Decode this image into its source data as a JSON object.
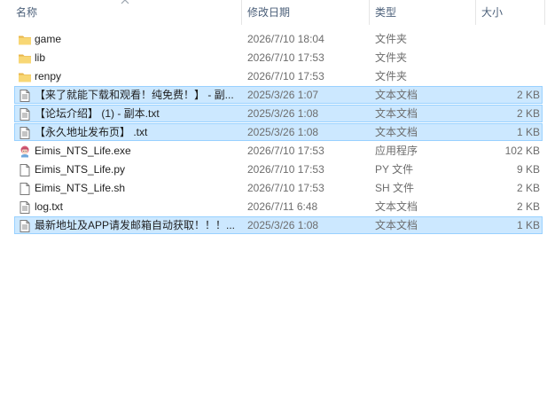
{
  "columns": {
    "name": "名称",
    "date": "修改日期",
    "type": "类型",
    "size": "大小"
  },
  "files": [
    {
      "name": "game",
      "date": "2026/7/10 18:04",
      "type": "文件夹",
      "size": "",
      "icon": "folder-icon",
      "selected": false
    },
    {
      "name": "lib",
      "date": "2026/7/10 17:53",
      "type": "文件夹",
      "size": "",
      "icon": "folder-icon",
      "selected": false
    },
    {
      "name": "renpy",
      "date": "2026/7/10 17:53",
      "type": "文件夹",
      "size": "",
      "icon": "folder-icon",
      "selected": false
    },
    {
      "name": "【来了就能下载和观看！纯免费！】 - 副...",
      "date": "2025/3/26 1:07",
      "type": "文本文档",
      "size": "2 KB",
      "icon": "text-document-icon",
      "selected": true
    },
    {
      "name": "【论坛介绍】 (1) - 副本.txt",
      "date": "2025/3/26 1:08",
      "type": "文本文档",
      "size": "2 KB",
      "icon": "text-document-icon",
      "selected": true
    },
    {
      "name": "【永久地址发布页】 .txt",
      "date": "2025/3/26 1:08",
      "type": "文本文档",
      "size": "1 KB",
      "icon": "text-document-icon",
      "selected": true
    },
    {
      "name": "Eimis_NTS_Life.exe",
      "date": "2026/7/10 17:53",
      "type": "应用程序",
      "size": "102 KB",
      "icon": "application-icon",
      "selected": false
    },
    {
      "name": "Eimis_NTS_Life.py",
      "date": "2026/7/10 17:53",
      "type": "PY 文件",
      "size": "9 KB",
      "icon": "blank-file-icon",
      "selected": false
    },
    {
      "name": "Eimis_NTS_Life.sh",
      "date": "2026/7/10 17:53",
      "type": "SH 文件",
      "size": "2 KB",
      "icon": "blank-file-icon",
      "selected": false
    },
    {
      "name": "log.txt",
      "date": "2026/7/11 6:48",
      "type": "文本文档",
      "size": "2 KB",
      "icon": "text-document-icon",
      "selected": false
    },
    {
      "name": "最新地址及APP请发邮箱自动获取！！！...",
      "date": "2025/3/26 1:08",
      "type": "文本文档",
      "size": "1 KB",
      "icon": "text-document-icon",
      "selected": true
    }
  ],
  "colors": {
    "selection_fill": "#cce8ff",
    "selection_border": "#99d1ff",
    "header_text": "#4c607a",
    "secondary_text": "#6d6d6d",
    "folder_yellow": "#f8d775"
  }
}
